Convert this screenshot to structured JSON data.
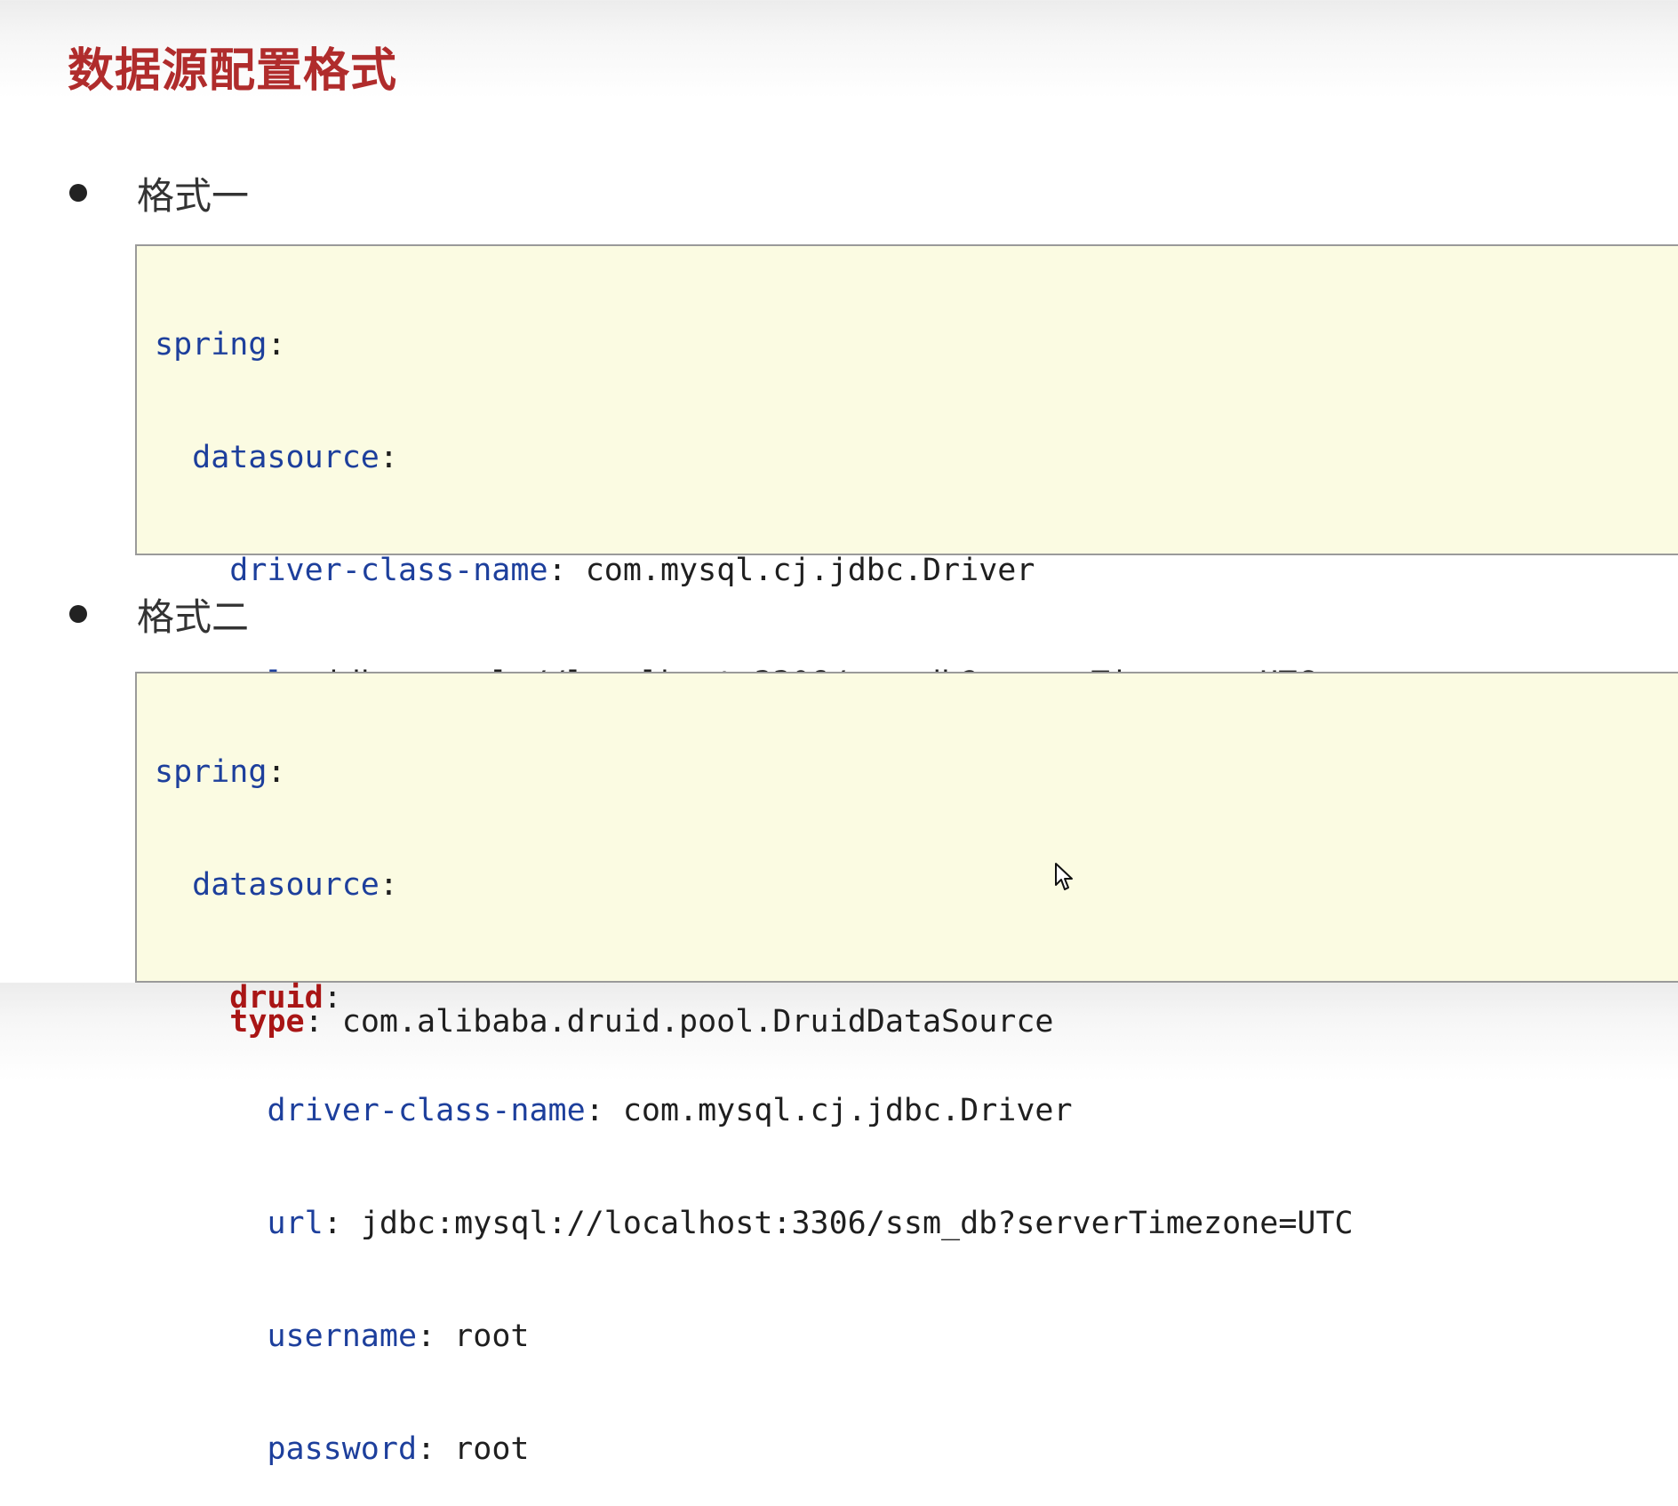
{
  "title": "数据源配置格式",
  "format_one": {
    "label": "格式一",
    "lines": [
      {
        "key": "spring",
        "value": ""
      },
      {
        "key": "datasource",
        "value": ""
      },
      {
        "key": "driver-class-name",
        "value": "com.mysql.cj.jdbc.Driver"
      },
      {
        "key": "url",
        "value": "jdbc:mysql://localhost:3306/ssm_db?serverTimezone=UTC"
      },
      {
        "key": "username",
        "value": "root"
      },
      {
        "key": "password",
        "value": "root"
      },
      {
        "key": "type",
        "value": "com.alibaba.druid.pool.DruidDataSource"
      }
    ]
  },
  "format_two": {
    "label": "格式二",
    "lines": [
      {
        "key": "spring",
        "value": ""
      },
      {
        "key": "datasource",
        "value": ""
      },
      {
        "key": "druid",
        "value": ""
      },
      {
        "key": "driver-class-name",
        "value": "com.mysql.cj.jdbc.Driver"
      },
      {
        "key": "url",
        "value": "jdbc:mysql://localhost:3306/ssm_db?serverTimezone=UTC"
      },
      {
        "key": "username",
        "value": "root"
      },
      {
        "key": "password",
        "value": "root"
      }
    ]
  },
  "colors": {
    "title": "#b02c2c",
    "key": "#1d3f9c",
    "highlight_key": "#a91515",
    "code_background": "#fbfbe2"
  }
}
